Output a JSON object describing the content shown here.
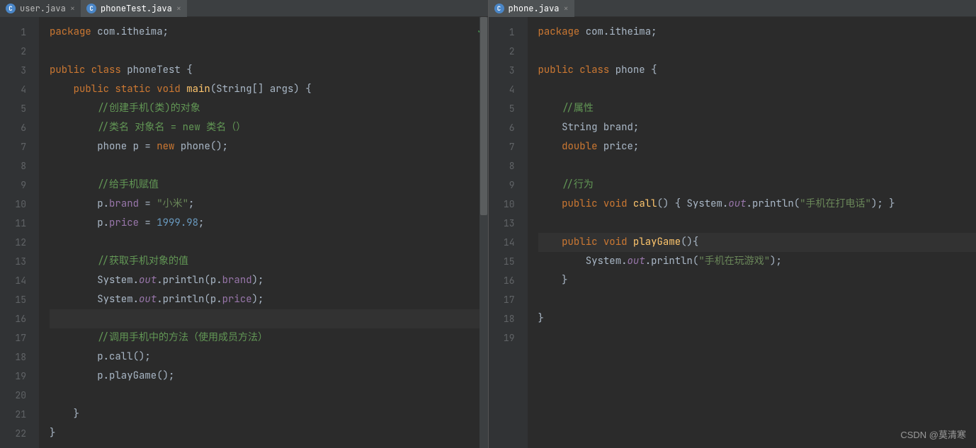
{
  "tabs_left": [
    {
      "name": "user.java",
      "active": false,
      "icon": "C"
    },
    {
      "name": "phoneTest.java",
      "active": true,
      "icon": "C"
    }
  ],
  "tabs_right": [
    {
      "name": "phone.java",
      "active": true,
      "icon": "C"
    }
  ],
  "left_lines": [
    "1",
    "2",
    "3",
    "4",
    "5",
    "6",
    "7",
    "8",
    "9",
    "10",
    "11",
    "12",
    "13",
    "14",
    "15",
    "16",
    "17",
    "18",
    "19",
    "20",
    "21",
    "22"
  ],
  "right_lines": [
    "1",
    "2",
    "3",
    "4",
    "5",
    "6",
    "7",
    "8",
    "9",
    "10",
    "13",
    "14",
    "15",
    "16",
    "17",
    "18",
    "19"
  ],
  "left_code": {
    "l1": {
      "pkg": "package ",
      "ns": "com.itheima;"
    },
    "l3": {
      "a": "public class ",
      "b": "phoneTest ",
      "c": "{"
    },
    "l4": {
      "a": "public static void ",
      "b": "main",
      "c": "(String[] args) {"
    },
    "l5": "//创建手机(类)的对象",
    "l6": "//类名 对象名 = new 类名（）",
    "l7": {
      "a": "phone ",
      "b": "p ",
      "c": "= ",
      "d": "new ",
      "e": "phone();"
    },
    "l9": "//给手机赋值",
    "l10": {
      "a": "p.",
      "b": "brand ",
      "c": "= ",
      "d": "\"小米\"",
      "e": ";"
    },
    "l11": {
      "a": "p.",
      "b": "price ",
      "c": "= ",
      "d": "1999.98",
      "e": ";"
    },
    "l13": "//获取手机对象的值",
    "l14": {
      "a": "System.",
      "b": "out",
      "c": ".println(p.",
      "d": "brand",
      "e": ");"
    },
    "l15": {
      "a": "System.",
      "b": "out",
      "c": ".println(p.",
      "d": "price",
      "e": ");"
    },
    "l17": "//调用手机中的方法（使用成员方法）",
    "l18": "p.call();",
    "l19": "p.playGame();",
    "l21": "}",
    "l22": "}"
  },
  "right_code": {
    "l1": {
      "pkg": "package ",
      "ns": "com.itheima;"
    },
    "l3": {
      "a": "public class ",
      "b": "phone ",
      "c": "{"
    },
    "l5": "//属性",
    "l6": {
      "a": "String ",
      "b": "brand;"
    },
    "l7": {
      "a": "double ",
      "b": "price;"
    },
    "l9": "//行为",
    "l10": {
      "a": "public void ",
      "b": "call",
      "c": "() { System.",
      "d": "out",
      "e": ".println(",
      "f": "\"手机在打电话\"",
      "g": "); }"
    },
    "l14": {
      "a": "public void ",
      "b": "playGame",
      "c": "(){"
    },
    "l15": {
      "a": "System.",
      "b": "out",
      "c": ".println(",
      "d": "\"手机在玩游戏\"",
      "e": ");"
    },
    "l16": "}",
    "l18": "}"
  },
  "watermark": "CSDN @莫清寒"
}
